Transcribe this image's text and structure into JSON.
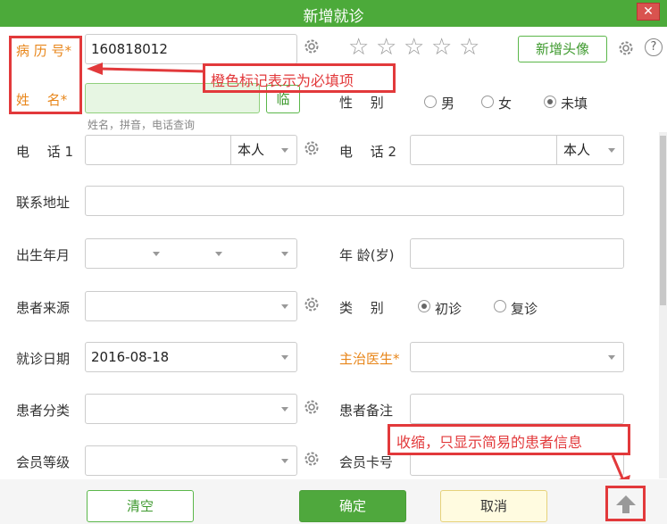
{
  "window": {
    "title": "新增就诊",
    "close_glyph": "✕"
  },
  "record_no": {
    "label": "病 历 号*",
    "value": "160818012"
  },
  "name": {
    "label": "姓 　名*",
    "placeholder": "",
    "hint": "姓名，拼音，电话查询",
    "temp_button": "临"
  },
  "rating": {
    "stars": 5,
    "filled": 0
  },
  "avatar_button": "新增头像",
  "annotations": {
    "required_note": "橙色标记表示为必填项",
    "collapse_note": "收缩，只显示简易的患者信息"
  },
  "gender": {
    "label": "性 　别",
    "options": [
      "男",
      "女",
      "未填"
    ],
    "selected": "未填"
  },
  "phone1": {
    "label": "电 　话 1",
    "value": "",
    "relation": "本人"
  },
  "phone2": {
    "label": "电 　话 2",
    "value": "",
    "relation": "本人"
  },
  "address": {
    "label": "联系地址",
    "value": ""
  },
  "birth": {
    "label": "出生年月"
  },
  "age": {
    "label": "年 龄(岁)",
    "value": ""
  },
  "source": {
    "label": "患者来源",
    "value": ""
  },
  "visit_type": {
    "label": "类 　别",
    "options": [
      "初诊",
      "复诊"
    ],
    "selected": "初诊"
  },
  "visit_date": {
    "label": "就诊日期",
    "value": "2016-08-18"
  },
  "doctor": {
    "label": "主治医生*",
    "value": ""
  },
  "category": {
    "label": "患者分类",
    "value": ""
  },
  "remark": {
    "label": "患者备注",
    "value": ""
  },
  "member_level": {
    "label": "会员等级",
    "value": ""
  },
  "member_card": {
    "label": "会员卡号",
    "value": ""
  },
  "footer": {
    "clear": "清空",
    "confirm": "确定",
    "cancel": "取消"
  },
  "colors": {
    "title_bar": "#4caa3a",
    "required": "#e8861a",
    "annotation": "#e2393b",
    "confirm": "#4fa83d"
  }
}
